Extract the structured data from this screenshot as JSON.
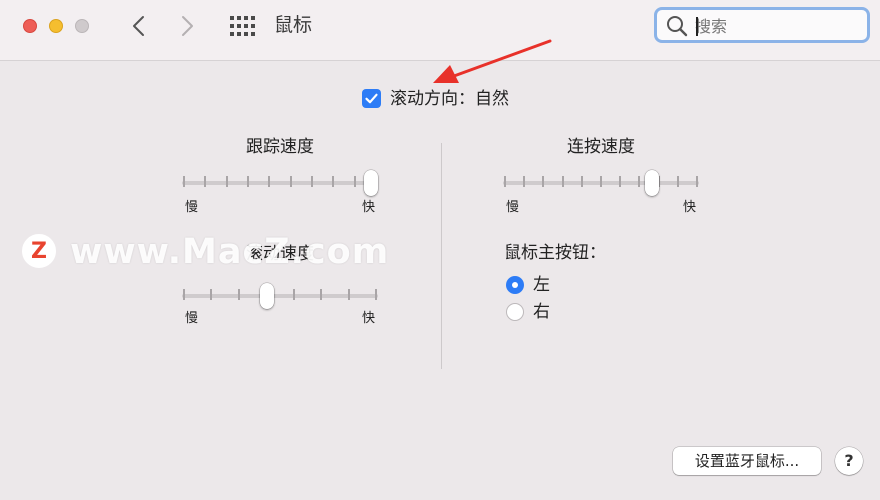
{
  "window": {
    "title": "鼠标",
    "search": {
      "placeholder": "搜索",
      "value": ""
    }
  },
  "scroll_direction": {
    "label": "滚动方向：自然",
    "checked": true
  },
  "tracking_speed": {
    "label": "跟踪速度",
    "min_label": "慢",
    "max_label": "快",
    "level": 1.0
  },
  "scroll_speed": {
    "label": "滚动速度",
    "min_label": "慢",
    "max_label": "快",
    "level": 0.43
  },
  "double_click_speed": {
    "label": "连按速度",
    "min_label": "慢",
    "max_label": "快",
    "level": 0.78
  },
  "primary_button": {
    "label": "鼠标主按钮：",
    "options": [
      {
        "label": "左",
        "selected": true
      },
      {
        "label": "右",
        "selected": false
      }
    ]
  },
  "footer": {
    "bluetooth_button": "设置蓝牙鼠标...",
    "help_button": "?"
  },
  "watermark": {
    "logo": "Z",
    "text": "www.MacZ.com"
  },
  "colors": {
    "accent": "#2d7cf6",
    "annotation_arrow": "#e8312a"
  }
}
